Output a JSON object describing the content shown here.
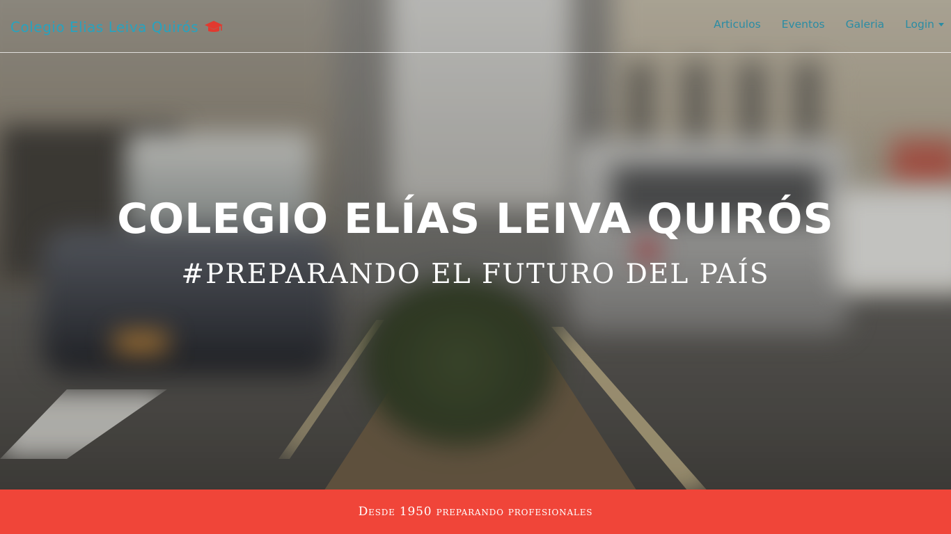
{
  "navbar": {
    "brand": "Colegio Elias Leiva Quirós",
    "brand_icon": "graduation-cap-icon",
    "links": [
      {
        "label": "Articulos"
      },
      {
        "label": "Eventos"
      },
      {
        "label": "Galeria"
      },
      {
        "label": "Login",
        "has_dropdown": true
      }
    ]
  },
  "hero": {
    "title": "COLEGIO ELÍAS LEIVA QUIRÓS",
    "subtitle": "#PREPARANDO EL FUTURO DEL PAÍS"
  },
  "band": {
    "text": "Desde 1950 preparando profesionales"
  },
  "colors": {
    "accent": "#27a3bf",
    "band": "#f04539"
  }
}
